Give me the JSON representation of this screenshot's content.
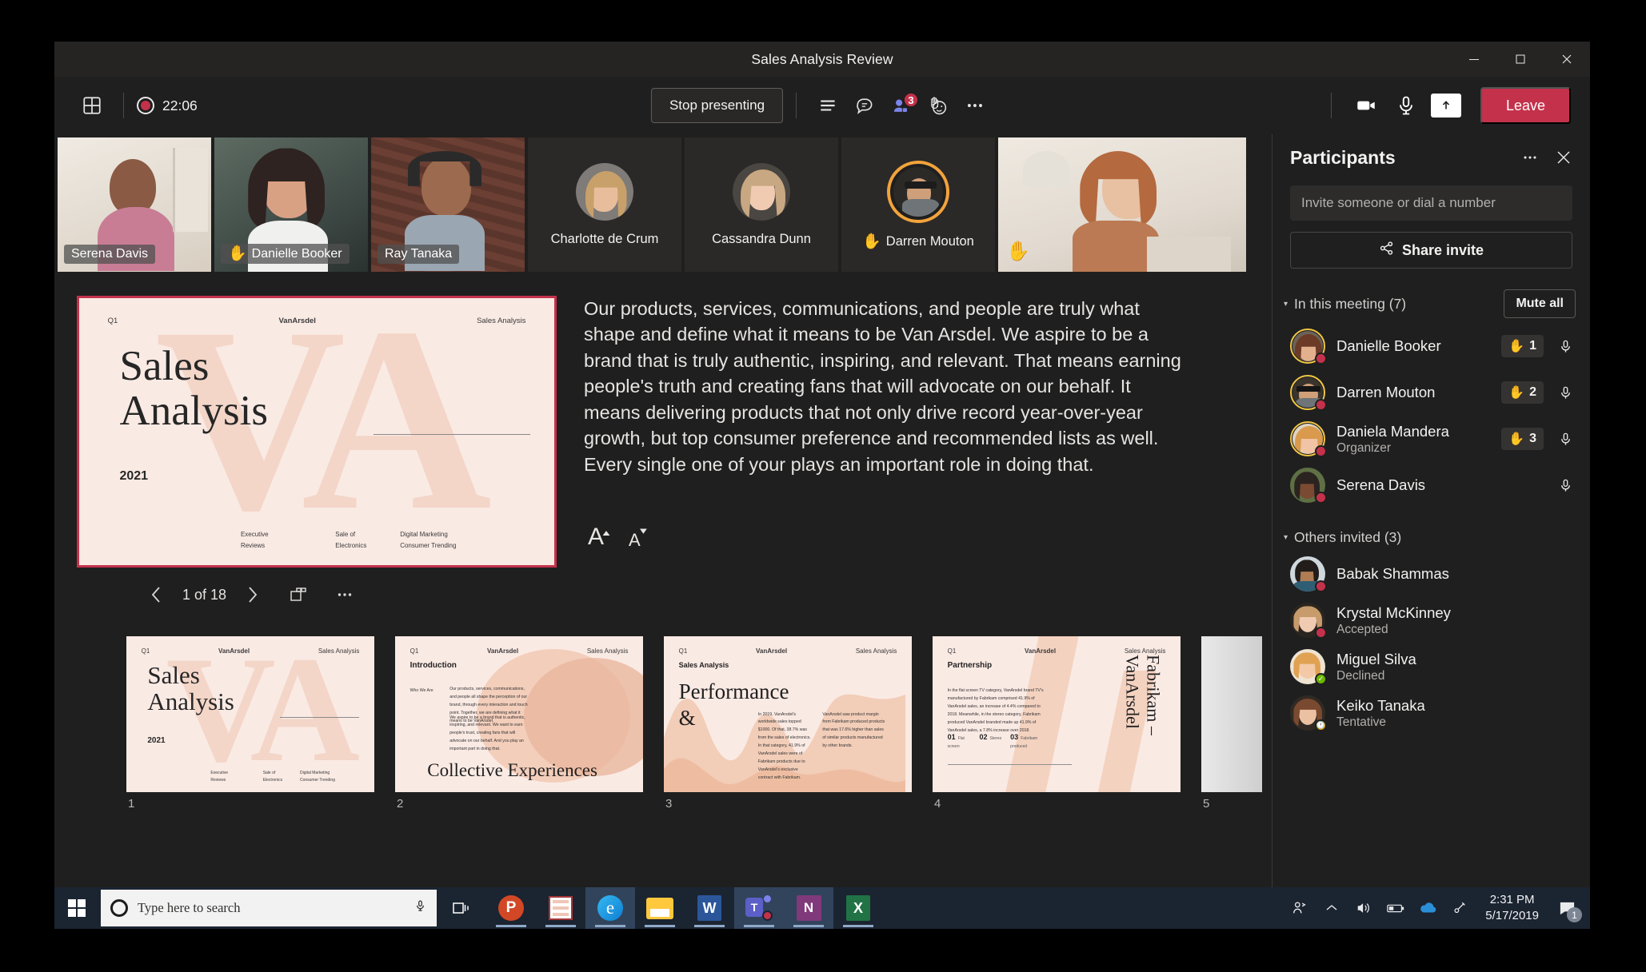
{
  "window": {
    "title": "Sales Analysis Review",
    "controls": {
      "minimize": "minimize-icon",
      "maximize": "maximize-icon",
      "close": "close-icon"
    }
  },
  "toolbar": {
    "grid_view_icon": "grid-layout-icon",
    "recording_time": "22:06",
    "stop_presenting_label": "Stop presenting",
    "icons": {
      "list": "lines-list-icon",
      "chat": "chat-bubble-icon",
      "people": "people-icon",
      "reactions": "raise-hand-reactions-icon",
      "more": "more-options-icon",
      "camera": "camera-icon",
      "mic": "microphone-icon",
      "share": "share-screen-icon"
    },
    "people_badge": "3",
    "leave_label": "Leave"
  },
  "filmstrip": [
    {
      "name": "Serena Davis",
      "video": true,
      "hand_raised": false,
      "speaking": false
    },
    {
      "name": "Danielle Booker",
      "video": true,
      "hand_raised": true,
      "speaking": false,
      "active": true
    },
    {
      "name": "Ray Tanaka",
      "video": true,
      "hand_raised": false,
      "speaking": false
    },
    {
      "name": "Charlotte de Crum",
      "video": false,
      "hand_raised": false,
      "speaking": false
    },
    {
      "name": "Cassandra Dunn",
      "video": false,
      "hand_raised": false,
      "speaking": false
    },
    {
      "name": "Darren Mouton",
      "video": false,
      "hand_raised": true,
      "speaking": true
    },
    {
      "name": "",
      "video": true,
      "hand_raised": true,
      "speaking": false
    }
  ],
  "presentation": {
    "slide_counter": "1 of 18",
    "prev_icon": "chevron-left-icon",
    "next_icon": "chevron-right-icon",
    "all_slides_icon": "all-slides-icon",
    "more_icon": "more-options-icon",
    "font_increase_icon": "increase-font-size-icon",
    "font_decrease_icon": "decrease-font-size-icon",
    "notes": "Our products, services, communications, and people are truly what shape and define what it means to be Van Arsdel. We aspire to be a brand that is truly authentic, inspiring, and relevant. That means earning people's truth and creating fans that will advocate on our behalf. It means delivering products that not only drive record year-over-year growth, but top consumer preference and recommended lists as well. Every single one of your plays an important role in doing that.",
    "current_slide": {
      "header_left": "Q1",
      "header_center": "VanArsdel",
      "header_right": "Sales Analysis",
      "title_line1": "Sales",
      "title_line2": "Analysis",
      "year": "2021",
      "footer": [
        "Executive\nReviews",
        "Sale of\nElectronics",
        "Digital Marketing\nConsumer Trending"
      ],
      "watermark": "VA"
    },
    "thumbnails": [
      {
        "number": "1",
        "selected": true,
        "kind": "title",
        "header_left": "Q1",
        "header_center": "VanArsdel",
        "header_right": "Sales Analysis",
        "title_line1": "Sales",
        "title_line2": "Analysis",
        "year": "2021",
        "footer": [
          "Executive\nReviews",
          "Sale of\nElectronics",
          "Digital Marketing\nConsumer Trending"
        ]
      },
      {
        "number": "2",
        "selected": false,
        "kind": "intro",
        "header_left": "Q1",
        "header_center": "VanArsdel",
        "header_right": "Sales Analysis",
        "section_label": "Introduction",
        "side_label": "Who We Are",
        "para1": "Our products, services, communications, and people all shape the perception of our brand, through every interaction and touch point. Together, we are defining what it means to be VanArsdel.",
        "para2": "We aspire to be a brand that is authentic, inspiring, and relevant. We want to earn people's trust, creating fans that will advocate on our behalf. And you play an important part in doing that.",
        "big_title": "Collective Experiences"
      },
      {
        "number": "3",
        "selected": false,
        "kind": "performance",
        "header_left": "Q1",
        "header_center": "VanArsdel",
        "header_right": "Sales Analysis",
        "section_label": "Sales Analysis",
        "title_line1": "Performance",
        "title_line2": "&",
        "para1": "In 2019, VanArsdel's worldwide sales topped $1000. Of that, 38.7% was from the sales of electronics. In that category, 41.9% of VanArsdel sales were of Fabrikam products due to VanArsdel's exclusive contract with Fabrikam.",
        "para2": "VanArsdel saw product margin from Fabrikam produced products that was 17.6% higher than sales of similar products manufactured by other brands."
      },
      {
        "number": "4",
        "selected": false,
        "kind": "partnership",
        "header_left": "Q1",
        "header_center": "VanArsdel",
        "header_right": "Sales Analysis",
        "section_label": "Partnership",
        "para1": "In the flat screen TV category, VanArsdel brand TV's manufactured by Fabrikam comprised 41.9% of VanArsdel sales, an increase of 4.4% compared to 2018. Meanwhile, in the stereo category, Fabrikam produced VanArsdel branded made up 41.9% of VanArsdel sales, a 7.8% increase over 2018.",
        "stats": [
          {
            "num": "01",
            "label": "Flat screen"
          },
          {
            "num": "02",
            "label": "Stereo"
          },
          {
            "num": "03",
            "label": "Fabrikam produced"
          }
        ],
        "vertical_title": "Fabrikam – VanArsdel"
      },
      {
        "number": "5",
        "selected": false,
        "kind": "partial"
      }
    ]
  },
  "panel": {
    "title": "Participants",
    "more_icon": "more-options-icon",
    "close_icon": "close-icon",
    "invite_placeholder": "Invite someone or dial a number",
    "invite_value": "",
    "share_invite_label": "Share invite",
    "share_icon": "share-link-icon",
    "in_meeting": {
      "label": "In this meeting (7)",
      "mute_all_label": "Mute all",
      "caret_icon": "chevron-down-icon",
      "people": [
        {
          "name": "Danielle Booker",
          "role": "",
          "hand_number": "1",
          "hand_icon": "raised-hand-icon",
          "mic_icon": "microphone-icon",
          "presence": "busy",
          "hand_ring": true
        },
        {
          "name": "Darren Mouton",
          "role": "",
          "hand_number": "2",
          "hand_icon": "raised-hand-icon",
          "mic_icon": "microphone-icon",
          "presence": "busy",
          "hand_ring": true
        },
        {
          "name": "Daniela Mandera",
          "role": "Organizer",
          "hand_number": "3",
          "hand_icon": "raised-hand-icon",
          "mic_icon": "microphone-icon",
          "presence": "busy",
          "hand_ring": true
        },
        {
          "name": "Serena Davis",
          "role": "",
          "hand_number": "",
          "hand_icon": "",
          "mic_icon": "microphone-icon",
          "presence": "busy",
          "hand_ring": false
        }
      ]
    },
    "others_invited": {
      "label": "Others invited (3)",
      "caret_icon": "chevron-down-icon",
      "people": [
        {
          "name": "Babak Shammas",
          "role": "",
          "presence": "busy"
        },
        {
          "name": "Krystal McKinney",
          "role": "Accepted",
          "presence": "busy"
        },
        {
          "name": "Miguel Silva",
          "role": "Declined",
          "presence": "avail"
        },
        {
          "name": "Keiko Tanaka",
          "role": "Tentative",
          "presence": "away"
        }
      ]
    }
  },
  "taskbar": {
    "start_icon": "windows-start-icon",
    "search_placeholder": "Type here to search",
    "cortana_icon": "cortana-circle-icon",
    "search_mic_icon": "microphone-icon",
    "task_view_icon": "task-view-icon",
    "apps": [
      {
        "name": "powerpoint-app",
        "letter": "P",
        "color": "#d24726",
        "active": false
      },
      {
        "name": "access-app",
        "letter": "",
        "color": "#a4373a",
        "active": false
      },
      {
        "name": "edge-app",
        "letter": "e",
        "color": "#0f7fd4",
        "active": true
      },
      {
        "name": "file-explorer-app",
        "letter": "",
        "color": "#ffc83d",
        "active": false
      },
      {
        "name": "word-app",
        "letter": "W",
        "color": "#2b579a",
        "active": false
      },
      {
        "name": "teams-app",
        "letter": "T",
        "color": "#5b5fc7",
        "active": true
      },
      {
        "name": "onenote-app",
        "letter": "N",
        "color": "#80397b",
        "active": true
      },
      {
        "name": "excel-app",
        "letter": "X",
        "color": "#217346",
        "active": false
      }
    ],
    "tray": {
      "people_icon": "tray-people-icon",
      "chevron_icon": "show-hidden-icons-icon",
      "volume_icon": "volume-icon",
      "battery_icon": "battery-icon",
      "onedrive_icon": "onedrive-cloud-icon",
      "network_icon": "network-pen-icon",
      "time": "2:31 PM",
      "date": "5/17/2019",
      "notification_icon": "notifications-icon",
      "notification_count": "1"
    }
  },
  "colors": {
    "accent_red": "#c4314b",
    "hand_yellow": "#f2c744",
    "active_orange": "#f2a33c",
    "thumb_selected": "#e2620f",
    "slide_bg": "#faeae4"
  }
}
